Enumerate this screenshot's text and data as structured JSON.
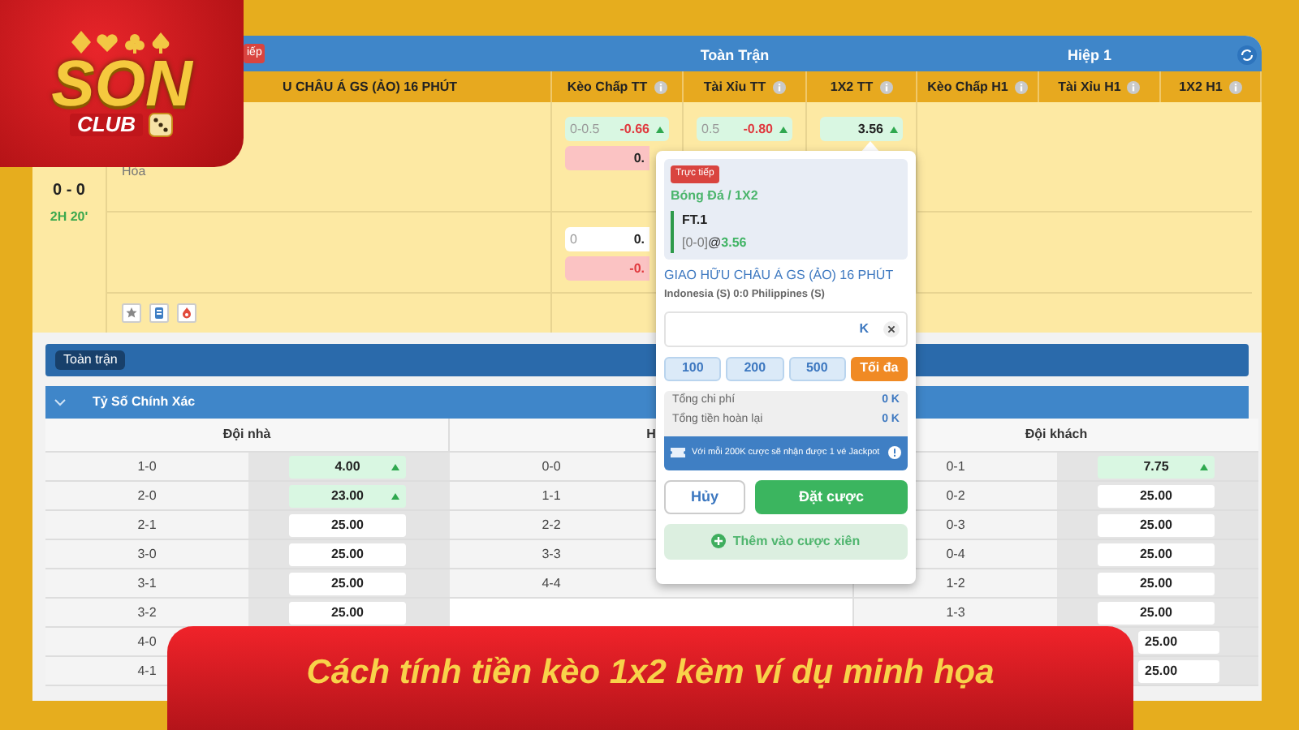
{
  "logo": {
    "wordmark": "SON",
    "tag": "CLUB"
  },
  "match_header": {
    "live_badge": "iếp",
    "groups": [
      "Toàn Trận",
      "Hiệp 1"
    ],
    "match_title": "U CHÂU Á GS (ẢO) 16 PHÚT",
    "market_columns": [
      "Kèo Chấp TT",
      "Tài Xỉu TT",
      "1X2 TT",
      "Kèo Chấp H1",
      "Tài Xỉu H1",
      "1X2 H1"
    ]
  },
  "match": {
    "score": "0 - 0",
    "clock": "2H 20'",
    "draw_label": "Hòa"
  },
  "odds_columns": [
    {
      "cells": [
        {
          "line": "0-0.5",
          "price": "-0.66",
          "negative": true,
          "color": "#d9f7e2",
          "rising": true
        },
        {
          "price": "0.",
          "negative": false,
          "color": "#fbc3c3",
          "rising": false
        },
        {
          "line": "0",
          "price": "0.",
          "negative": false,
          "color": "#ffffff",
          "rising": false
        },
        {
          "price": "-0.",
          "negative": true,
          "color": "#fbc3c3",
          "rising": false
        }
      ]
    },
    {
      "cells": [
        {
          "line": "0.5",
          "price": "-0.80",
          "negative": true,
          "color": "#d9f7e2",
          "rising": true
        }
      ]
    },
    {
      "cells": [
        {
          "price": "3.56",
          "negative": false,
          "color": "#d9f7e2",
          "rising": true
        }
      ]
    }
  ],
  "section_tab": "Toàn trận",
  "market": {
    "title": "Tỷ Số Chính Xác",
    "expanded": true
  },
  "score_columns": [
    {
      "header": "Đội nhà",
      "rows": [
        {
          "score": "1-0",
          "price": "4.00",
          "color": "#d9f7e2",
          "rising": true
        },
        {
          "score": "2-0",
          "price": "23.00",
          "color": "#d9f7e2",
          "rising": true
        },
        {
          "score": "2-1",
          "price": "25.00",
          "color": "#ffffff",
          "rising": false
        },
        {
          "score": "3-0",
          "price": "25.00",
          "color": "#ffffff",
          "rising": false
        },
        {
          "score": "3-1",
          "price": "25.00",
          "color": "#ffffff",
          "rising": false
        },
        {
          "score": "3-2",
          "price": "25.00",
          "color": "#ffffff",
          "rising": false
        },
        {
          "score": "4-0"
        },
        {
          "score": "4-1"
        }
      ]
    },
    {
      "header": "H",
      "rows": [
        {
          "score": "0-0"
        },
        {
          "score": "1-1"
        },
        {
          "score": "2-2"
        },
        {
          "score": "3-3"
        },
        {
          "score": "4-4"
        }
      ]
    },
    {
      "header": "Đội khách",
      "rows": [
        {
          "score": "0-1",
          "price": "7.75",
          "color": "#d9f7e2",
          "rising": true
        },
        {
          "score": "0-2",
          "price": "25.00",
          "color": "#ffffff",
          "rising": false
        },
        {
          "score": "0-3",
          "price": "25.00",
          "color": "#ffffff",
          "rising": false
        },
        {
          "score": "0-4",
          "price": "25.00",
          "color": "#ffffff",
          "rising": false
        },
        {
          "score": "1-2",
          "price": "25.00",
          "color": "#ffffff",
          "rising": false
        },
        {
          "score": "1-3",
          "price": "25.00",
          "color": "#ffffff",
          "rising": false
        },
        {
          "price": "25.00",
          "color": "#ffffff",
          "rising": false
        },
        {
          "price": "25.00",
          "color": "#ffffff",
          "rising": false
        }
      ]
    }
  ],
  "bet_slip": {
    "live_badge": "Trực tiếp",
    "sport_market": "Bóng Đá / 1X2",
    "pick": "FT.1",
    "pick_score": "[0-0]",
    "at": "@",
    "odds": "3.56",
    "event": "GIAO HỮU CHÂU Á GS (ẢO) 16 PHÚT",
    "teams": "Indonesia (S) 0:0 Philippines (S)",
    "stake_unit": "K",
    "quick_stakes": [
      {
        "label": "100",
        "kind": "amount"
      },
      {
        "label": "200",
        "kind": "amount"
      },
      {
        "label": "500",
        "kind": "amount"
      },
      {
        "label": "Tối đa",
        "kind": "max"
      }
    ],
    "summary": [
      {
        "label": "Tổng chi phí",
        "value": "0 K"
      },
      {
        "label": "Tổng tiền hoàn lại",
        "value": "0 K"
      }
    ],
    "promo": "Với mỗi 200K cược sẽ nhận được 1 vé Jackpot",
    "cancel": "Hủy",
    "place": "Đặt cược",
    "add_parlay": {
      "label": "Thêm vào cược xiên",
      "disabled": true
    }
  },
  "banner": {
    "headline": "Cách tính tiền kèo 1x2 kèm ví dụ minh họa"
  }
}
